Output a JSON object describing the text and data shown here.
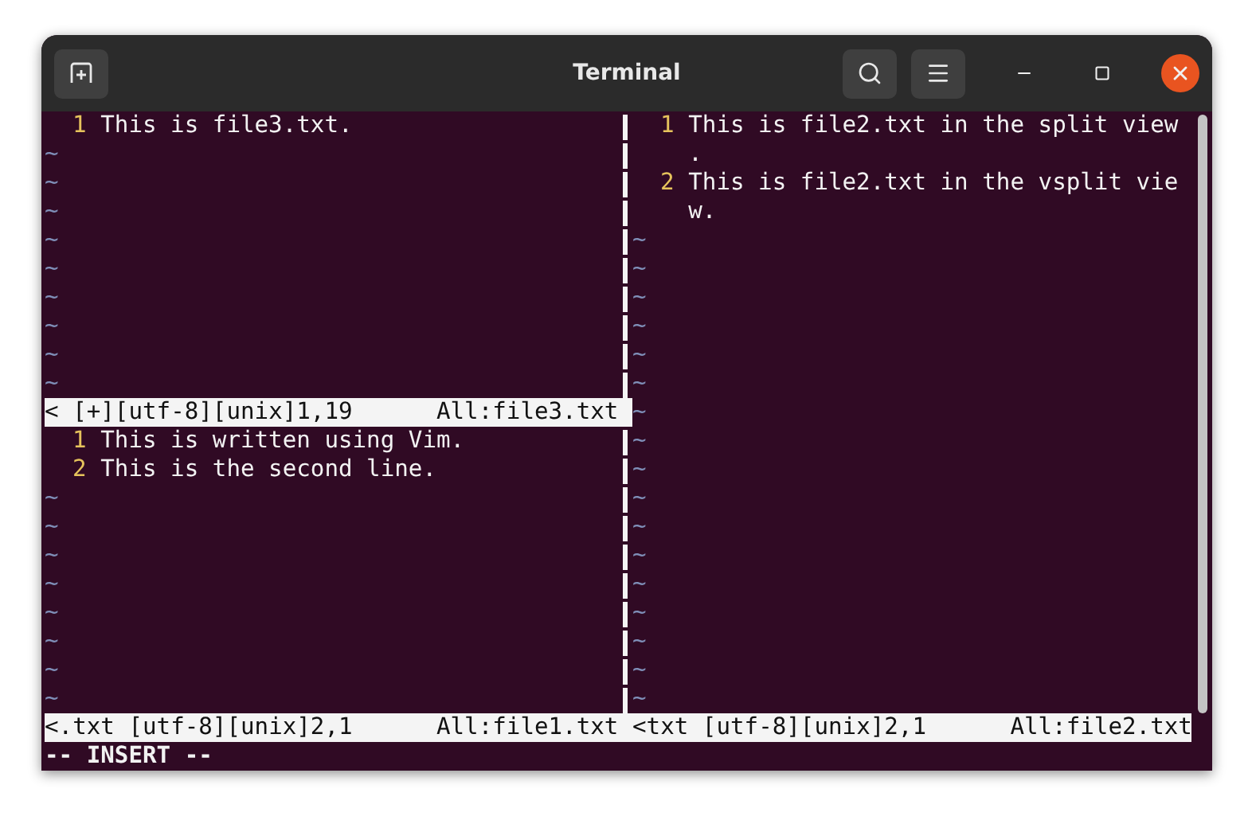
{
  "window": {
    "title": "Terminal"
  },
  "left_panes": [
    {
      "rows": [
        {
          "number": "1",
          "text": "This is file3.txt."
        }
      ],
      "filler": [
        "~",
        "~",
        "~",
        "~",
        "~",
        "~",
        "~",
        "~",
        "~"
      ],
      "status": {
        "left": "< [+][utf-8][unix]1,19",
        "right": "All:file3.txt"
      }
    },
    {
      "rows": [
        {
          "number": "1",
          "text": "This is written using Vim."
        },
        {
          "number": "2",
          "text": "This is the second line."
        }
      ],
      "filler": [
        "~",
        "~",
        "~",
        "~",
        "~",
        "~",
        "~",
        "~"
      ],
      "status": {
        "left": "<.txt [utf-8][unix]2,1",
        "right": "All:file1.txt"
      }
    }
  ],
  "right_pane": {
    "rows": [
      {
        "number": "1",
        "text": "This is file2.txt in the split view"
      },
      {
        "text": "."
      },
      {
        "number": "2",
        "text": "This is file2.txt in the vsplit vie"
      },
      {
        "text": "w."
      }
    ],
    "filler": [
      "~",
      "~",
      "~",
      "~",
      "~",
      "~",
      "~",
      "~",
      "~",
      "~",
      "~",
      "~",
      "~",
      "~",
      "~",
      "~",
      "~"
    ],
    "status": {
      "left": "<txt [utf-8][unix]2,1",
      "right": "All:file2.txt"
    }
  },
  "mode_line": "-- INSERT --"
}
